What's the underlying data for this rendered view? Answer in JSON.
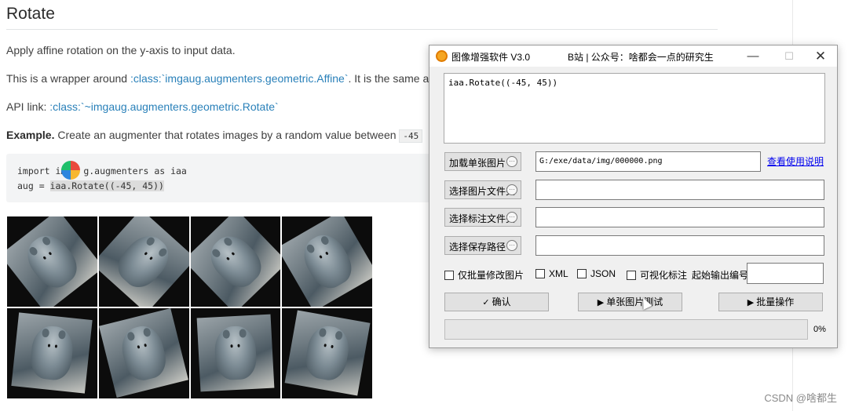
{
  "doc": {
    "title": "Rotate",
    "p1": "Apply affine rotation on the y-axis to input data.",
    "p2_pre": "This is a wrapper around ",
    "p2_link": ":class:`imgaug.augmenters.geometric.Affine`",
    "p2_post": ". It is the same a",
    "p3_pre": "API link: ",
    "p3_link": ":class:`~imgaug.augmenters.geometric.Rotate`",
    "p4_bold": "Example.",
    "p4_text": " Create an augmenter that rotates images by a random value between ",
    "p4_code": "-45",
    "code_line1_a": "import im",
    "code_line1_b": "g.augmenters as iaa",
    "code_line2_a": "aug = ",
    "code_line2_hl": "iaa.Rotate((-45, 45))"
  },
  "app": {
    "title": "图像增强软件 V3.0",
    "subtitle": "B站 | 公众号：啥都会一点的研究生",
    "window_controls": {
      "minimize": "—",
      "maximize": "☐",
      "close": "✕"
    },
    "code_text": "iaa.Rotate((-45, 45))",
    "buttons": {
      "load_single": "加载单张图片",
      "select_image_folder": "选择图片文件夹",
      "select_label_folder": "选择标注文件夹",
      "select_save_path": "选择保存路径",
      "dots": "···"
    },
    "fields": {
      "single_image_path": "G:/exe/data/img/000000.png",
      "image_folder": "",
      "label_folder": "",
      "save_path": ""
    },
    "help_link": "查看使用说明",
    "checkboxes": {
      "batch_modify_images": "仅批量修改图片",
      "xml": "XML",
      "json": "JSON",
      "visualize_labels": "可视化标注"
    },
    "start_index_label": "起始输出编号",
    "start_index_value": "",
    "actions": {
      "confirm": "确认",
      "single_test": "单张图片测试",
      "batch_run": "批量操作"
    },
    "progress": {
      "value": 0,
      "text": "0%"
    },
    "icons": {
      "app": "app-logo-icon",
      "confirm": "check-icon",
      "play": "play-icon"
    }
  },
  "watermark": "CSDN @啥都生"
}
